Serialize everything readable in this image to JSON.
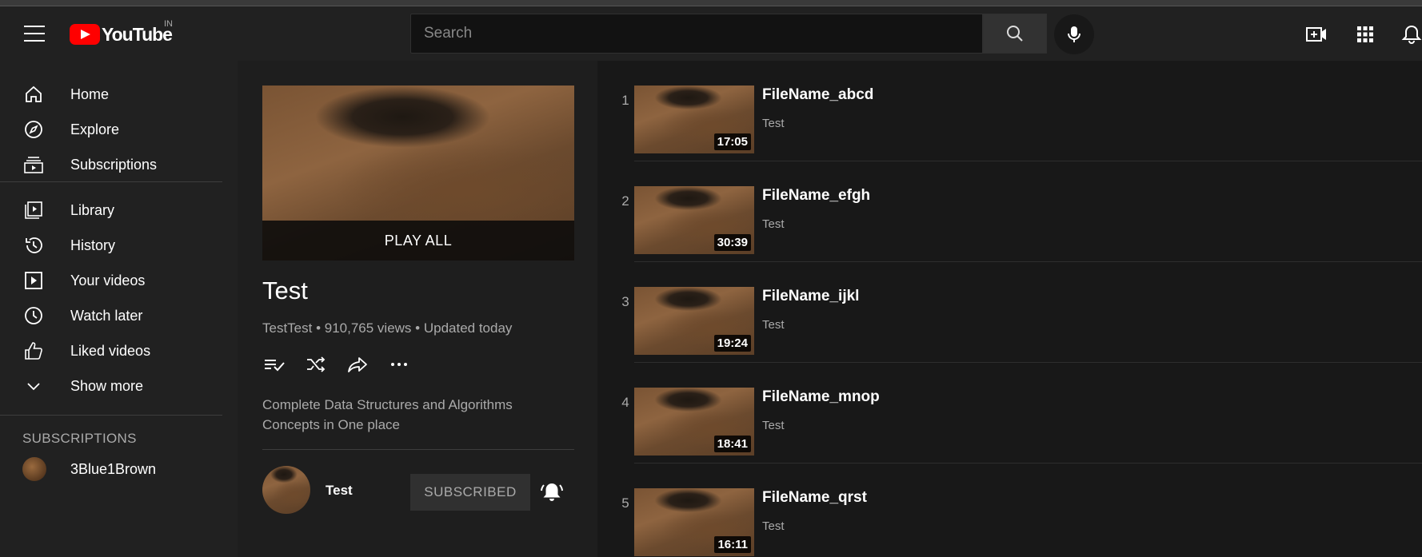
{
  "header": {
    "logo_text": "YouTube",
    "logo_region": "IN",
    "search_placeholder": "Search",
    "icons": [
      "menu-icon",
      "search-icon",
      "mic-icon",
      "create-icon",
      "apps-icon",
      "notifications-icon"
    ]
  },
  "sidebar": {
    "items": [
      {
        "label": "Home",
        "icon": "home-icon"
      },
      {
        "label": "Explore",
        "icon": "explore-icon"
      },
      {
        "label": "Subscriptions",
        "icon": "subscriptions-icon"
      },
      {
        "label": "Library",
        "icon": "library-icon"
      },
      {
        "label": "History",
        "icon": "history-icon"
      },
      {
        "label": "Your videos",
        "icon": "your-videos-icon"
      },
      {
        "label": "Watch later",
        "icon": "watch-later-icon"
      },
      {
        "label": "Liked videos",
        "icon": "like-icon"
      },
      {
        "label": "Show more",
        "icon": "chevron-down-icon"
      }
    ],
    "subscriptions_heading": "SUBSCRIPTIONS",
    "subscriptions": [
      {
        "name": "3Blue1Brown"
      }
    ]
  },
  "playlist": {
    "play_all": "PLAY ALL",
    "title": "Test",
    "stats": "TestTest • 910,765 views • Updated today",
    "description": "Complete Data Structures and Algorithms Concepts in One place",
    "owner": "Test",
    "subscribe_label": "SUBSCRIBED",
    "actions": [
      "save-playlist-icon",
      "shuffle-icon",
      "share-icon",
      "more-icon"
    ]
  },
  "videos": [
    {
      "index": "1",
      "title": "FileName_abcd",
      "channel": "Test",
      "duration": "17:05"
    },
    {
      "index": "2",
      "title": "FileName_efgh",
      "channel": "Test",
      "duration": "30:39"
    },
    {
      "index": "3",
      "title": "FileName_ijkl",
      "channel": "Test",
      "duration": "19:24"
    },
    {
      "index": "4",
      "title": "FileName_mnop",
      "channel": "Test",
      "duration": "18:41"
    },
    {
      "index": "5",
      "title": "FileName_qrst",
      "channel": "Test",
      "duration": "16:11"
    }
  ]
}
